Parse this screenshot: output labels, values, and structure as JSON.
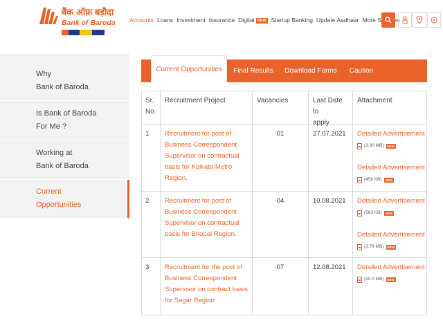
{
  "brand": {
    "hindi_name": "बैंक ऑफ़ बड़ौदा",
    "english_name": "Bank of Baroda",
    "colors": {
      "primary": "#e8622a",
      "strip": [
        "#e8622a",
        "#1b3a8c",
        "#f5c518",
        "#1b3a8c"
      ]
    }
  },
  "nav": {
    "items": [
      {
        "label": "Accounts",
        "active": true
      },
      {
        "label": "Loans"
      },
      {
        "label": "Investment"
      },
      {
        "label": "Insurance"
      },
      {
        "label": "Digital",
        "badge": "NEW"
      },
      {
        "label": "Startup Banking"
      },
      {
        "label": "Update Aadhaar"
      },
      {
        "label": "More Services"
      }
    ],
    "icons": [
      "search-icon",
      "people-icon",
      "location-pin-icon",
      "help-icon"
    ]
  },
  "sidebar": {
    "items": [
      {
        "line1": "Why",
        "line2": "Bank of Baroda"
      },
      {
        "line1": "Is Bank of Baroda",
        "line2": "For Me ?"
      },
      {
        "line1": "Working at",
        "line2": "Bank of Baroda"
      },
      {
        "line1": "Current",
        "line2": "Opportunities",
        "current": true
      }
    ]
  },
  "tabs": [
    {
      "label": "Current Opportunities",
      "active": true
    },
    {
      "label": "Final Results"
    },
    {
      "label": "Download Forms"
    },
    {
      "label": "Caution"
    }
  ],
  "table": {
    "headers": {
      "sr": [
        "Sr.",
        "No."
      ],
      "project": "Recruitment Project",
      "vacancies": "Vacancies",
      "last_date": [
        "Last Date to",
        "apply"
      ],
      "attachment": "Attachment"
    },
    "rows": [
      {
        "sr": "1",
        "project": "Recruitment for post of Business Correspondent Supervisor on contractual basis for Kolkata Metro Region.",
        "vacancies": "01",
        "last_date": "27.07.2021",
        "attachments": [
          {
            "label": "Detailed Advertisement",
            "size": "(3.30 MB)",
            "badge": "NEW"
          },
          {
            "label": "Detailed Advertisement",
            "size": "(456 KB)",
            "badge": "NEW"
          }
        ]
      },
      {
        "sr": "2",
        "project": "Recruitment for post of Business Correspondent Supervisor on contractual basis for Bhopal Region.",
        "vacancies": "04",
        "last_date": "10.08.2021",
        "attachments": [
          {
            "label": "Detailed Advertisement",
            "size": "(563 KB)",
            "badge": "NEW"
          },
          {
            "label": "Detailed Advertisement",
            "size": "(3.79 MB)",
            "badge": "NEW"
          }
        ]
      },
      {
        "sr": "3",
        "project": "Recruitment for the post of Business Correspondent Supervisor on contract basis for Sagar Region",
        "vacancies": "07",
        "last_date": "12.08.2021",
        "attachments": [
          {
            "label": "Detailed Advertisement",
            "size": "(10.0 MB)",
            "badge": "NEW"
          }
        ]
      }
    ]
  }
}
